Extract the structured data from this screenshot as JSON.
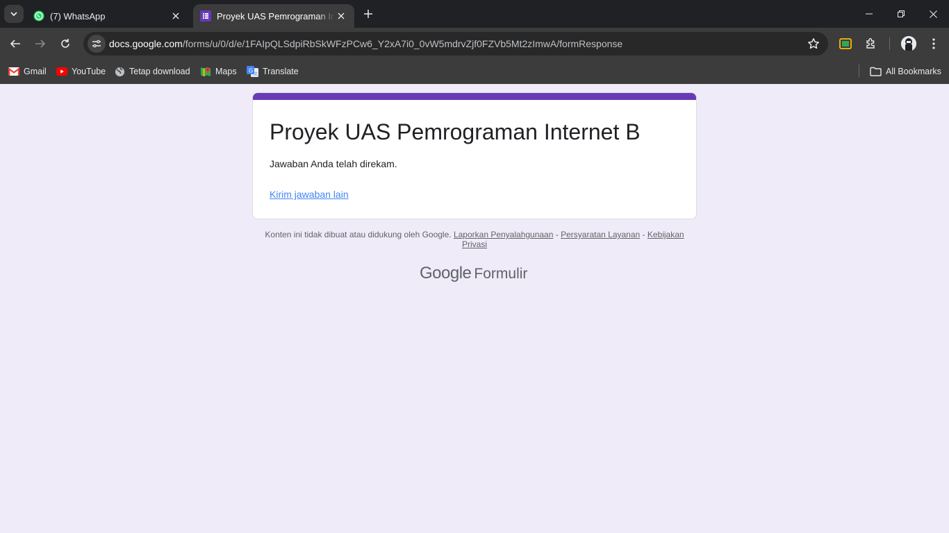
{
  "tabs": [
    {
      "title": "(7) WhatsApp",
      "icon": "whatsapp-icon"
    },
    {
      "title": "Proyek UAS Pemrograman Internet B",
      "icon": "google-forms-icon",
      "active": true
    }
  ],
  "omnibox": {
    "host": "docs.google.com",
    "path": "/forms/u/0/d/e/1FAIpQLSdpiRbSkWFzPCw6_Y2xA7i0_0vW5mdrvZjf0FZVb5Mt2zImwA/formResponse"
  },
  "bookmarks": [
    {
      "label": "Gmail",
      "icon": "gmail-icon"
    },
    {
      "label": "YouTube",
      "icon": "youtube-icon"
    },
    {
      "label": "Tetap download",
      "icon": "globe-icon"
    },
    {
      "label": "Maps",
      "icon": "maps-icon"
    },
    {
      "label": "Translate",
      "icon": "translate-icon"
    }
  ],
  "all_bookmarks": "All Bookmarks",
  "form": {
    "title": "Proyek UAS Pemrograman Internet B",
    "message": "Jawaban Anda telah direkam.",
    "link": "Kirim jawaban lain",
    "accent_color": "#673ab7"
  },
  "footer": {
    "disclaimer": "Konten ini tidak dibuat atau didukung oleh Google.",
    "report": "Laporkan Penyalahgunaan",
    "sep1": "-",
    "terms": "Persyaratan Layanan",
    "sep2": "-",
    "privacy": "Kebijakan Privasi"
  },
  "logo": {
    "google": "Google",
    "product": "Formulir"
  },
  "colors": {
    "page_bg": "#f0ebf8",
    "link": "#4285f4",
    "chrome_dark": "#202124",
    "chrome_toolbar": "#3c3c3c"
  }
}
